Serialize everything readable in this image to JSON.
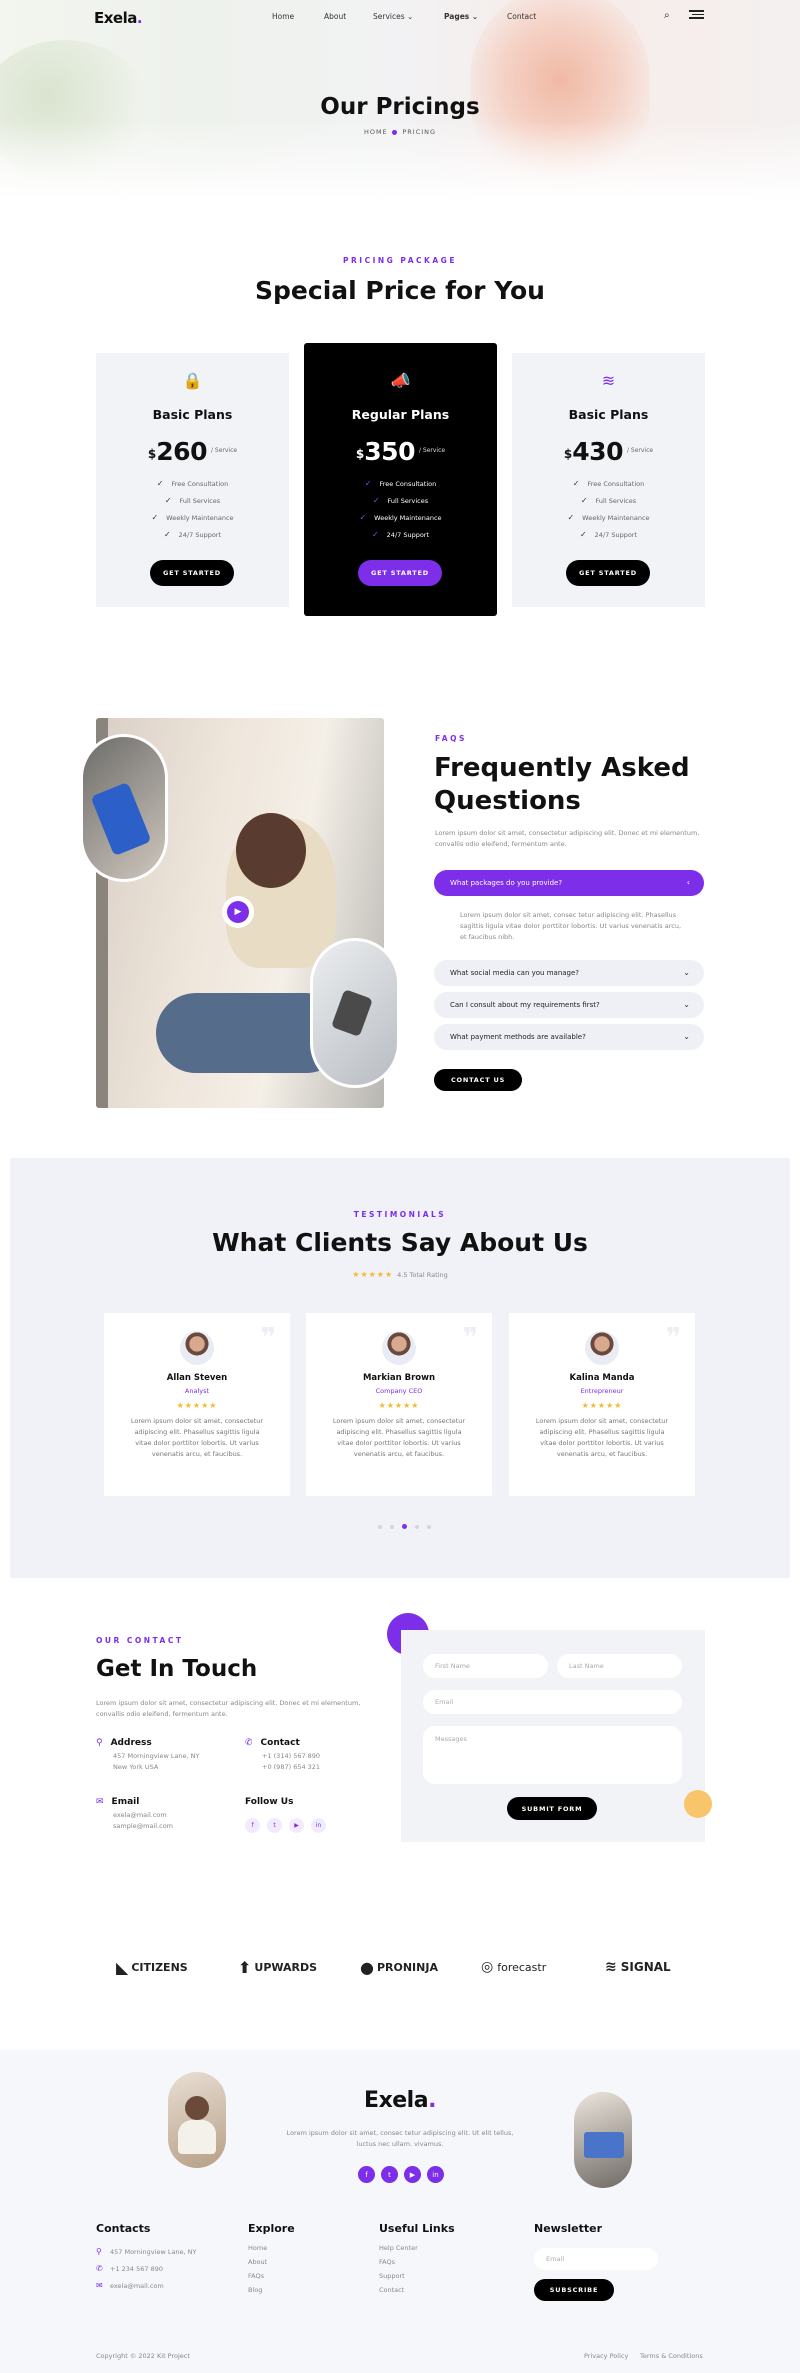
{
  "brand": {
    "name": "Exela",
    "dot": "."
  },
  "nav": {
    "home": "Home",
    "about": "About",
    "services": "Services",
    "pages": "Pages",
    "contact": "Contact"
  },
  "hero": {
    "title": "Our Pricings",
    "crumb_home": "HOME",
    "crumb_current": "PRICING",
    "crumb_sep": "●"
  },
  "pricing": {
    "eyebrow": "PRICING PACKAGE",
    "title": "Special Price for You",
    "plans": [
      {
        "icon": "lock-icon",
        "glyph": "🔒",
        "name": "Basic Plans",
        "currency": "$",
        "amount": "260",
        "per": "/ Service",
        "features": [
          "Free Consultation",
          "Full Services",
          "Weekly Maintenance",
          "24/7 Support"
        ],
        "button": "GET STARTED"
      },
      {
        "icon": "megaphone-icon",
        "glyph": "📣",
        "name": "Regular Plans",
        "currency": "$",
        "amount": "350",
        "per": "/ Service",
        "features": [
          "Free Consultation",
          "Full Services",
          "Weekly Maintenance",
          "24/7 Support"
        ],
        "button": "GET STARTED"
      },
      {
        "icon": "layers-icon",
        "glyph": "≋",
        "name": "Basic Plans",
        "currency": "$",
        "amount": "430",
        "per": "/ Service",
        "features": [
          "Free Consultation",
          "Full Services",
          "Weekly Maintenance",
          "24/7 Support"
        ],
        "button": "GET STARTED"
      }
    ]
  },
  "faq": {
    "eyebrow": "FAQS",
    "title_line1": "Frequently Asked",
    "title_line2": "Questions",
    "intro": "Lorem ipsum dolor sit amet, consectetur adipiscing elit. Donec et mi elementum, convallis odio eleifend, fermentum ante.",
    "items": [
      {
        "q": "What packages do you provide?",
        "a": "Lorem ipsum dolor sit amet, consec tetur adipiscing elit. Phasellus sagittis ligula vitae dolor porttitor lobortis. Ut varius venenatis arcu, et faucibus nibh."
      },
      {
        "q": "What social media can you manage?"
      },
      {
        "q": "Can I consult about my requirements first?"
      },
      {
        "q": "What payment methods are available?"
      }
    ],
    "button": "CONTACT US"
  },
  "testimonials": {
    "eyebrow": "TESTIMONIALS",
    "title": "What Clients Say About Us",
    "rating_text": "4.5 Total Rating",
    "stars": "★★★★★",
    "cards": [
      {
        "name": "Allan Steven",
        "role": "Analyst",
        "stars": "★★★★★",
        "text": "Lorem ipsum dolor sit amet, consectetur adipiscing elit. Phasellus sagittis ligula vitae dolor porttitor lobortis. Ut varius venenatis arcu, et faucibus."
      },
      {
        "name": "Markian Brown",
        "role": "Company CEO",
        "stars": "★★★★★",
        "text": "Lorem ipsum dolor sit amet, consectetur adipiscing elit. Phasellus sagittis ligula vitae dolor porttitor lobortis. Ut varius venenatis arcu, et faucibus."
      },
      {
        "name": "Kalina Manda",
        "role": "Entrepreneur",
        "stars": "★★★★★",
        "text": "Lorem ipsum dolor sit amet, consectetur adipiscing elit. Phasellus sagittis ligula vitae dolor porttitor lobortis. Ut varius venenatis arcu, et faucibus."
      }
    ]
  },
  "contact": {
    "eyebrow": "OUR CONTACT",
    "title": "Get In Touch",
    "intro": "Lorem ipsum dolor sit amet, consectetur adipiscing elit. Donec et mi elementum, convallis odio eleifend, fermentum ante.",
    "address_label": "Address",
    "address_line1": "457 Morningview Lane, NY",
    "address_line2": "New York USA",
    "contact_label": "Contact",
    "phone1": "+1 (314) 567 890",
    "phone2": "+0 (987) 654 321",
    "email_label": "Email",
    "email1": "exela@mail.com",
    "email2": "sample@mail.com",
    "follow_label": "Follow Us",
    "form": {
      "first_name": "First Name",
      "last_name": "Last Name",
      "email": "Email",
      "message": "Messages",
      "submit": "SUBMIT FORM"
    }
  },
  "brands": [
    "CITIZENS",
    "UPWARDS",
    "PRONINJA",
    "forecastr",
    "SIGNAL"
  ],
  "footer": {
    "about": "Lorem ipsum dolor sit amet, consec tetur adipiscing elit. Ut elit tellus, luctus nec ullam. vivamus.",
    "contacts_title": "Contacts",
    "address": "457 Morningview Lane, NY",
    "phone": "+1 234 567 890",
    "email": "exela@mail.com",
    "explore_title": "Explore",
    "explore": [
      "Home",
      "About",
      "FAQs",
      "Blog"
    ],
    "links_title": "Useful Links",
    "links": [
      "Help Center",
      "FAQs",
      "Support",
      "Contact"
    ],
    "newsletter_title": "Newsletter",
    "newsletter_placeholder": "Email",
    "subscribe": "SUBSCRIBE",
    "copyright": "Copyright © 2022 Kit Project",
    "privacy": "Privacy Policy",
    "terms": "Terms & Conditions"
  },
  "colors": {
    "accent": "#7c2ee8",
    "star": "#f5b82e",
    "dark": "#000000"
  }
}
